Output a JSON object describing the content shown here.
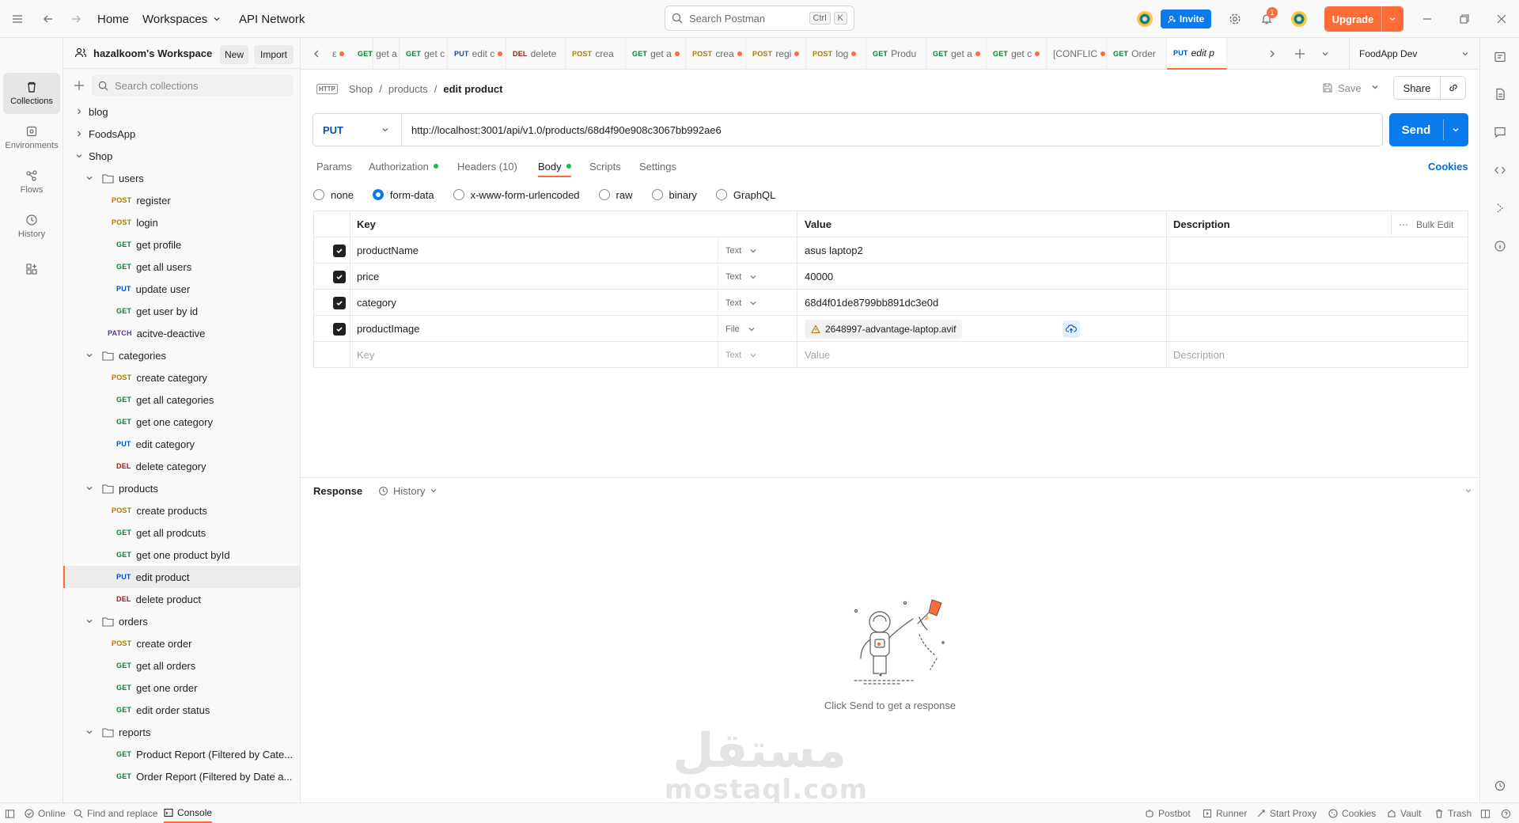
{
  "topbar": {
    "home": "Home",
    "workspaces": "Workspaces",
    "api_network": "API Network",
    "search_placeholder": "Search Postman",
    "search_kbd_1": "Ctrl",
    "search_kbd_2": "K",
    "invite": "Invite",
    "notifications_count": "1",
    "upgrade": "Upgrade"
  },
  "rail": {
    "collections": "Collections",
    "environments": "Environments",
    "flows": "Flows",
    "history": "History"
  },
  "sidebar": {
    "workspace_name": "hazalkoom's Workspace",
    "new_label": "New",
    "import_label": "Import",
    "search_placeholder": "Search collections",
    "tree": [
      {
        "label": "blog"
      },
      {
        "label": "FoodsApp"
      },
      {
        "label": "Shop"
      },
      {
        "label": "users"
      },
      {
        "method": "POST",
        "label": "register"
      },
      {
        "method": "POST",
        "label": "login"
      },
      {
        "method": "GET",
        "label": "get profile"
      },
      {
        "method": "GET",
        "label": "get all users"
      },
      {
        "method": "PUT",
        "label": "update user"
      },
      {
        "method": "GET",
        "label": "get user by id"
      },
      {
        "method": "PATCH",
        "label": "acitve-deactive"
      },
      {
        "label": "categories"
      },
      {
        "method": "POST",
        "label": "create category"
      },
      {
        "method": "GET",
        "label": "get all categories"
      },
      {
        "method": "GET",
        "label": "get one category"
      },
      {
        "method": "PUT",
        "label": "edit category"
      },
      {
        "method": "DEL",
        "label": "delete category"
      },
      {
        "label": "products"
      },
      {
        "method": "POST",
        "label": "create products"
      },
      {
        "method": "GET",
        "label": "get all prodcuts"
      },
      {
        "method": "GET",
        "label": "get one product byId"
      },
      {
        "method": "PUT",
        "label": "edit product"
      },
      {
        "method": "DEL",
        "label": "delete product"
      },
      {
        "label": "orders"
      },
      {
        "method": "POST",
        "label": "create order"
      },
      {
        "method": "GET",
        "label": "get all orders"
      },
      {
        "method": "GET",
        "label": "get one order"
      },
      {
        "method": "GET",
        "label": "edit order status"
      },
      {
        "label": "reports"
      },
      {
        "method": "GET",
        "label": "Product Report (Filtered by Cate..."
      },
      {
        "method": "GET",
        "label": "Order Report (Filtered by Date a..."
      }
    ]
  },
  "tabs": [
    {
      "method": "",
      "label": "ε"
    },
    {
      "method": "GET",
      "label": "get a"
    },
    {
      "method": "GET",
      "label": "get c"
    },
    {
      "method": "PUT",
      "label": "edit c"
    },
    {
      "method": "DEL",
      "label": "delete"
    },
    {
      "method": "POST",
      "label": "crea"
    },
    {
      "method": "GET",
      "label": "get a"
    },
    {
      "method": "POST",
      "label": "crea"
    },
    {
      "method": "POST",
      "label": "regi"
    },
    {
      "method": "POST",
      "label": "log"
    },
    {
      "method": "GET",
      "label": "Produ"
    },
    {
      "method": "GET",
      "label": "get a"
    },
    {
      "method": "GET",
      "label": "get c"
    },
    {
      "method": "",
      "label": "[CONFLIC"
    },
    {
      "method": "GET",
      "label": "Order"
    },
    {
      "method": "PUT",
      "label": "edit p"
    }
  ],
  "environment": "FoodApp Dev",
  "request": {
    "breadcrumb_1": "Shop",
    "breadcrumb_2": "products",
    "breadcrumb_3": "edit product",
    "save": "Save",
    "share": "Share",
    "method": "PUT",
    "url": "http://localhost:3001/api/v1.0/products/68d4f90e908c3067bb992ae6",
    "send": "Send",
    "tabs": {
      "params": "Params",
      "authorization": "Authorization",
      "headers": "Headers (10)",
      "body": "Body",
      "scripts": "Scripts",
      "settings": "Settings",
      "cookies": "Cookies"
    },
    "body_modes": {
      "none": "none",
      "form_data": "form-data",
      "urlencoded": "x-www-form-urlencoded",
      "raw": "raw",
      "binary": "binary",
      "graphql": "GraphQL"
    },
    "table": {
      "col_key": "Key",
      "col_value": "Value",
      "col_description": "Description",
      "bulk_edit": "Bulk Edit",
      "rows": [
        {
          "key": "productName",
          "type": "Text",
          "value": "asus laptop2"
        },
        {
          "key": "price",
          "type": "Text",
          "value": "40000"
        },
        {
          "key": "category",
          "type": "Text",
          "value": "68d4f01de8799bb891dc3e0d"
        },
        {
          "key": "productImage",
          "type": "File",
          "value": "2648997-advantage-laptop.avif"
        }
      ],
      "placeholder_key": "Key",
      "placeholder_type": "Text",
      "placeholder_value": "Value",
      "placeholder_description": "Description"
    }
  },
  "response": {
    "title": "Response",
    "history": "History",
    "empty_message": "Click Send to get a response"
  },
  "watermark": {
    "arabic": "مستقل",
    "latin": "mostaql.com"
  },
  "statusbar": {
    "online": "Online",
    "find_replace": "Find and replace",
    "console": "Console",
    "postbot": "Postbot",
    "runner": "Runner",
    "start_proxy": "Start Proxy",
    "cookies": "Cookies",
    "vault": "Vault",
    "trash": "Trash"
  },
  "colors": {
    "accent": "#ff6c37",
    "primary": "#097bed",
    "get": "#007f31",
    "post": "#ad7a03",
    "put": "#0053b8",
    "del": "#8e1a10"
  }
}
